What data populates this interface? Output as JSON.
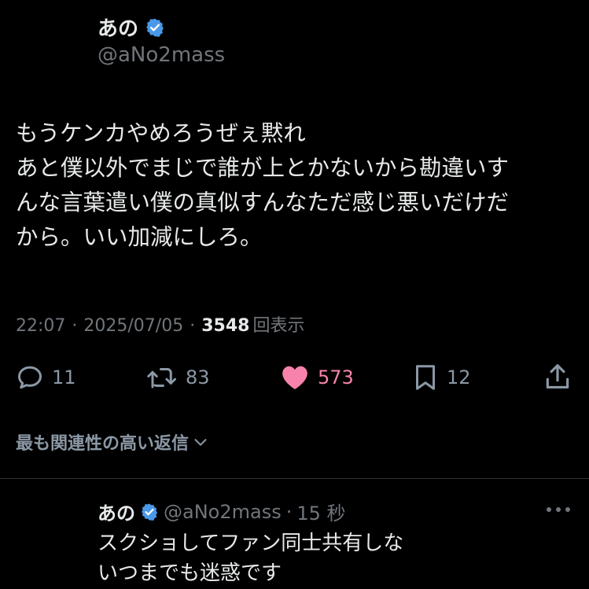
{
  "author": {
    "name": "あの",
    "handle": "@aNo2mass",
    "verified_color": "#4a99e9"
  },
  "tweet": {
    "lines": [
      "もうケンカやめろうぜぇ黙れ",
      "あと僕以外でまじで誰が上とかないから勘違いす",
      "んな言葉遣い僕の真似すんなただ感じ悪いだけだ",
      "から。いい加減にしろ。"
    ]
  },
  "meta": {
    "time": "22:07",
    "date": "2025/07/05",
    "separator": "·",
    "views_count": "3548",
    "views_label": "回表示"
  },
  "actions": {
    "reply_count": "11",
    "retweet_count": "83",
    "like_count": "573",
    "bookmark_count": "12",
    "like_color": "#f91880",
    "icons": [
      "reply-icon",
      "retweet-icon",
      "heart-icon",
      "bookmark-icon",
      "share-icon"
    ]
  },
  "sort": {
    "label": "最も関連性の高い返信"
  },
  "reply": {
    "name": "あの",
    "handle": "@aNo2mass",
    "dot": "·",
    "time": "15 秒",
    "lines": [
      "スクショしてファン同士共有しな",
      "いつまでも迷惑です"
    ]
  }
}
